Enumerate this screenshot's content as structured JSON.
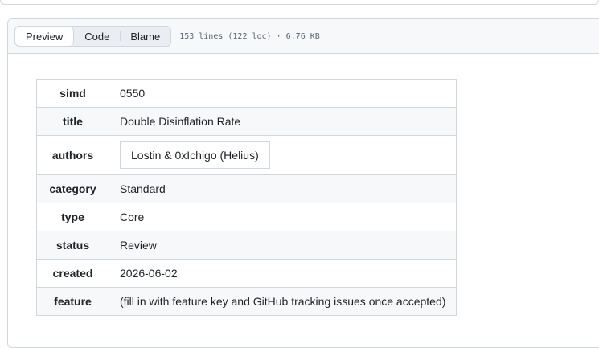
{
  "view_tabs": [
    {
      "label": "Preview",
      "active": true
    },
    {
      "label": "Code",
      "active": false
    },
    {
      "label": "Blame",
      "active": false
    }
  ],
  "file_info": "153 lines (122 loc) · 6.76 KB",
  "metadata": {
    "simd": {
      "key": "simd",
      "value": "0550"
    },
    "title": {
      "key": "title",
      "value": "Double Disinflation Rate"
    },
    "authors": {
      "key": "authors",
      "value": "Lostin & 0xIchigo (Helius)"
    },
    "category": {
      "key": "category",
      "value": "Standard"
    },
    "type": {
      "key": "type",
      "value": "Core"
    },
    "status": {
      "key": "status",
      "value": "Review"
    },
    "created": {
      "key": "created",
      "value": "2026-06-02"
    },
    "feature": {
      "key": "feature",
      "value": "(fill in with feature key and GitHub tracking issues once accepted)"
    }
  }
}
